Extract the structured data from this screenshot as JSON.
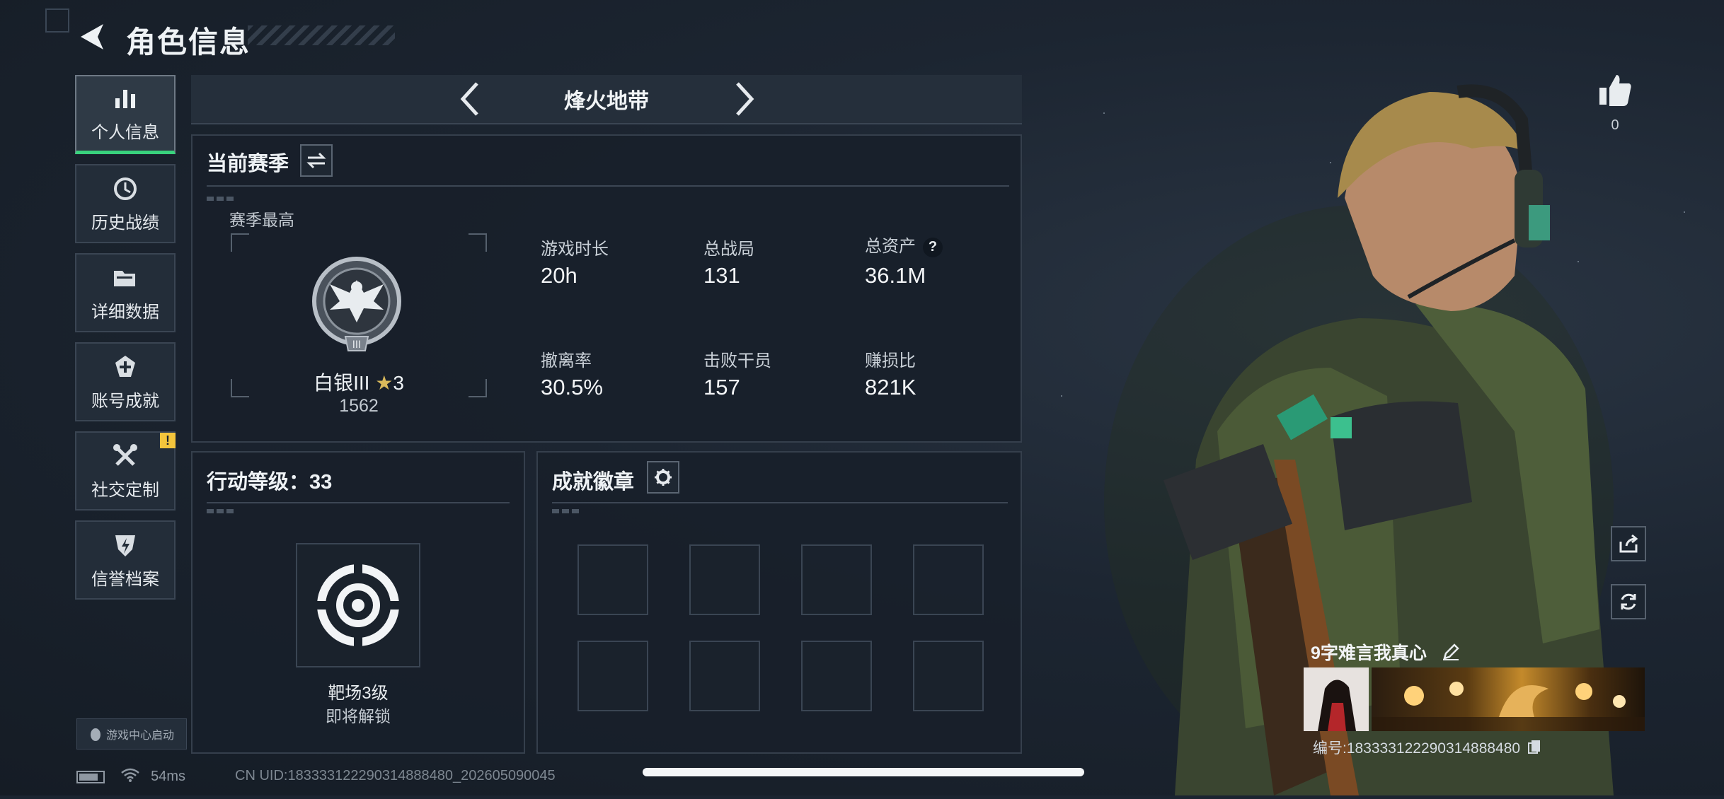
{
  "header": {
    "title": "角色信息"
  },
  "sidebar": {
    "items": [
      {
        "label": "个人信息",
        "icon": "bar-chart-icon",
        "active": true
      },
      {
        "label": "历史战绩",
        "icon": "clock-history-icon"
      },
      {
        "label": "详细数据",
        "icon": "folder-icon"
      },
      {
        "label": "账号成就",
        "icon": "achievement-icon"
      },
      {
        "label": "社交定制",
        "icon": "tools-icon",
        "badge": "!"
      },
      {
        "label": "信誉档案",
        "icon": "shield-bolt-icon"
      }
    ],
    "game_center": "游戏中心启动"
  },
  "mode": {
    "name": "烽火地带"
  },
  "season": {
    "title": "当前赛季",
    "best_label": "赛季最高",
    "rank_name": "白银III",
    "rank_stars": "3",
    "rank_score": "1562",
    "stats": [
      {
        "label": "游戏时长",
        "value": "20h"
      },
      {
        "label": "总战局",
        "value": "131"
      },
      {
        "label": "总资产",
        "value": "36.1M",
        "help": "?"
      },
      {
        "label": "撤离率",
        "value": "30.5%"
      },
      {
        "label": "击败干员",
        "value": "157"
      },
      {
        "label": "赚损比",
        "value": "821K"
      }
    ]
  },
  "action_level": {
    "title": "行动等级：33",
    "item_name": "靶场3级",
    "item_status": "即将解锁"
  },
  "badges": {
    "title": "成就徽章",
    "slots": 8
  },
  "profile": {
    "likes": "0",
    "nickname": "9字难言我真心",
    "id_text": "编号:18333312229031488848​0"
  },
  "status": {
    "ping": "54ms"
  },
  "footer": {
    "uid": "CN UID:183333122290314888480_202605090045"
  },
  "colors": {
    "accent_green": "#39d27d",
    "warning": "#f3c43c",
    "background": "#1b2430"
  }
}
